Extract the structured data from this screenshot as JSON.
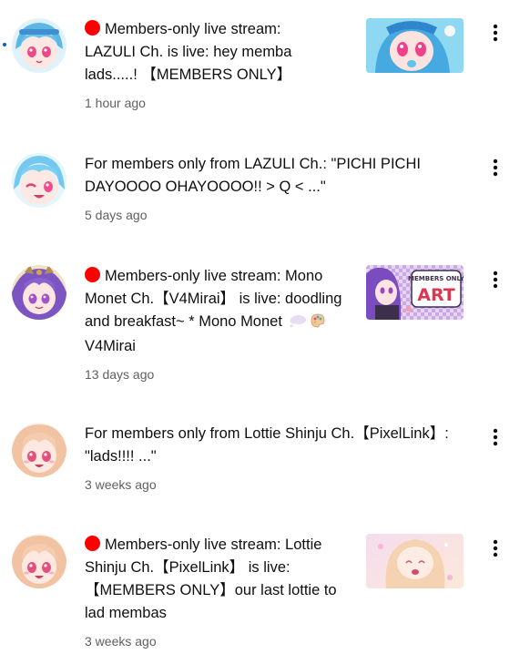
{
  "notifications": [
    {
      "unread": true,
      "live": true,
      "message": "Members-only live stream: LAZULI Ch. is live: hey memba lads.....! 【MEMBERS ONLY】",
      "time": "1 hour ago",
      "avatar_icon": "lazuli-avatar",
      "thumbnail_icon": "lazuli-stream-thumbnail",
      "avatar_colors": [
        "#6fc6ea",
        "#f4c9c9"
      ]
    },
    {
      "unread": false,
      "live": false,
      "message": "For members only from LAZULI Ch.: \"PICHI PICHI DAYOOOO OHAYOOOO!! > Q < ...\"",
      "time": "5 days ago",
      "avatar_icon": "lazuli-avatar-wink",
      "avatar_colors": [
        "#7fd0ee",
        "#fbd9d9"
      ]
    },
    {
      "unread": false,
      "live": true,
      "message_before_emoji": "Members-only live stream: Mono Monet Ch.【V4Mirai】 is live: doodling and breakfast~ * Mono Monet",
      "message_after_emoji": "V4Mirai",
      "emojis": [
        "thought-bubble-icon",
        "palette-icon"
      ],
      "time": "13 days ago",
      "avatar_icon": "mono-monet-avatar",
      "thumbnail_icon": "members-only-art-thumbnail",
      "thumbnail_text": [
        "MEMBERS ONLY",
        "ART"
      ],
      "avatar_colors": [
        "#8b5fc9",
        "#e8d7a8"
      ]
    },
    {
      "unread": false,
      "live": false,
      "message": "For members only from Lottie Shinju Ch.【PixelLink】: \"lads!!!! ...\"",
      "time": "3 weeks ago",
      "avatar_icon": "lottie-shinju-avatar",
      "avatar_colors": [
        "#f3c8a8",
        "#fbe3d3"
      ]
    },
    {
      "unread": false,
      "live": true,
      "message": "Members-only live stream: Lottie Shinju Ch.【PixelLink】 is live: 【MEMBERS ONLY】our last lottie to lad membas",
      "time": "3 weeks ago",
      "avatar_icon": "lottie-shinju-avatar",
      "thumbnail_icon": "lottie-stream-thumbnail",
      "avatar_colors": [
        "#f3c8a8",
        "#fbe3d3"
      ]
    }
  ],
  "menu_icon": "more-vertical-icon",
  "colors": {
    "live_red": "#ff0000",
    "unread_blue": "#065fd4",
    "time_gray": "#606060",
    "text": "#0f0f0f"
  }
}
